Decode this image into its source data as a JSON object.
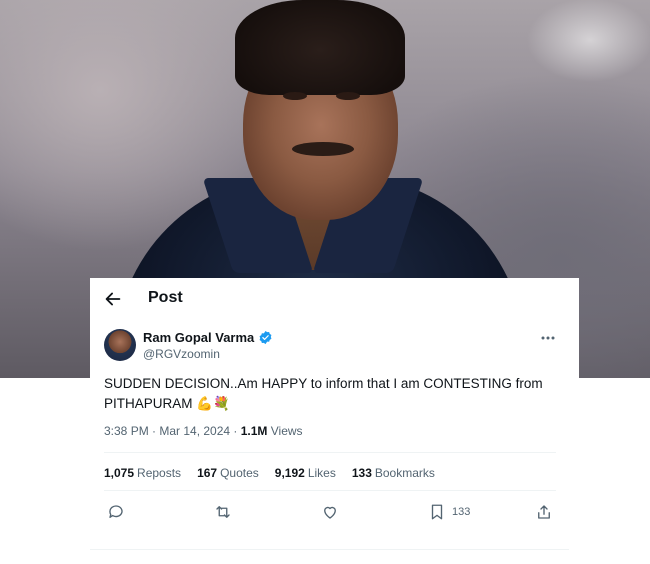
{
  "header": {
    "title": "Post"
  },
  "author": {
    "name": "Ram Gopal Varma",
    "handle": "@RGVzoomin"
  },
  "tweet": {
    "text": "SUDDEN DECISION..Am HAPPY to inform that I am CONTESTING from PITHAPURAM 💪💐"
  },
  "meta": {
    "time_date": "3:38 PM · Mar 14, 2024 · ",
    "views_count": "1.1M",
    "views_label": " Views"
  },
  "stats": {
    "reposts_count": "1,075",
    "reposts_label": "Reposts",
    "quotes_count": "167",
    "quotes_label": "Quotes",
    "likes_count": "9,192",
    "likes_label": "Likes",
    "bookmarks_count": "133",
    "bookmarks_label": "Bookmarks"
  },
  "actions": {
    "bookmark_count": "133"
  },
  "icons": [
    "back-arrow-icon",
    "verified-badge-icon",
    "more-icon",
    "reply-icon",
    "repost-icon",
    "like-icon",
    "bookmark-icon",
    "share-icon"
  ],
  "colors": {
    "verified": "#1d9bf0",
    "text": "#0f1419",
    "secondary": "#536471",
    "divider": "#eff3f4"
  }
}
